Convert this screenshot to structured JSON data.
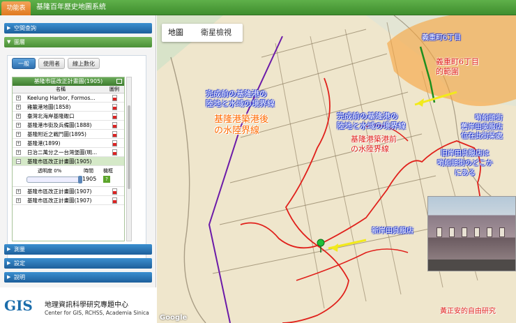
{
  "topbar": {
    "func_tab": "功能表",
    "title": "基隆百年歷史地圖系統"
  },
  "sidebar": {
    "sections": [
      {
        "label": "空間查詢",
        "arrow": "▶"
      },
      {
        "label": "圖層",
        "arrow": "▼"
      },
      {
        "label": "測量",
        "arrow": "▶"
      },
      {
        "label": "設定",
        "arrow": "▶"
      },
      {
        "label": "說明",
        "arrow": "▶"
      }
    ],
    "subtabs": [
      "一般",
      "使用者",
      "線上數化"
    ],
    "grid_title": "基隆市區改正計畫圖(1905)",
    "col_name": "名稱",
    "col_legend": "圖例",
    "layers": [
      {
        "label": "Keelung Harbor, Formos...",
        "toggle": "+"
      },
      {
        "label": "雞籠港地圖(1858)",
        "toggle": "+"
      },
      {
        "label": "臺灣北海岸基隆礮口",
        "toggle": "+"
      },
      {
        "label": "基隆港市街及兵備圖(1888)",
        "toggle": "+"
      },
      {
        "label": "基隆附近之戰鬥圖(1895)",
        "toggle": "+"
      },
      {
        "label": "基隆港(1899)",
        "toggle": "+"
      },
      {
        "label": "日治二萬分之一台灣堡圖(明...",
        "toggle": "+"
      },
      {
        "label": "基隆市區改正計畫圖(1905)",
        "toggle": "−"
      }
    ],
    "sub_labels": {
      "opacity": "透明度 0%",
      "time": "時間",
      "legend": "機框"
    },
    "time_value": "1905",
    "layers_after": [
      {
        "label": "基隆市區改正計畫圖(1907)",
        "toggle": "+"
      },
      {
        "label": "基隆市區改正計畫圖(1907)",
        "toggle": "+"
      }
    ],
    "pager": {
      "page": "1",
      "of": "/ 6",
      "size": "10",
      "total": "51"
    }
  },
  "logo": {
    "mark": "GIS",
    "name_cn": "地理資訊科學研究專題中心",
    "name_en": "Center for GIS, RCHSS, Academia Sinica"
  },
  "map": {
    "type_buttons": [
      "地圖",
      "衛星檢視"
    ],
    "annotations": {
      "a1": [
        "完成前の基隆港の",
        "陸地と水域の境界線"
      ],
      "a2": [
        "基隆港築港後",
        "の水陸界線"
      ],
      "a3": [
        "完成前の基隆港の",
        "陸地と水域の境界線"
      ],
      "a4": [
        "基隆港築港前",
        "の水陸界線"
      ],
      "a5": "義重町6丁目",
      "a6": [
        "義重町6丁目",
        "的範圍"
      ],
      "a7": [
        "哨船頭街",
        "舊岸田吳服店",
        "位在此街某處"
      ],
      "a8": [
        "旧岸田呉服店は",
        "哨船頭街のどこか",
        "にある"
      ],
      "a9": "新岸田呉服店",
      "a10": "黃正安的自由研究"
    },
    "google": "Google",
    "colors": {
      "purple_boundary": "#6b1aa8",
      "red_boundary": "#e0201b",
      "green_street": "#1e8f1e",
      "orange_area": "#f7a23a"
    }
  }
}
